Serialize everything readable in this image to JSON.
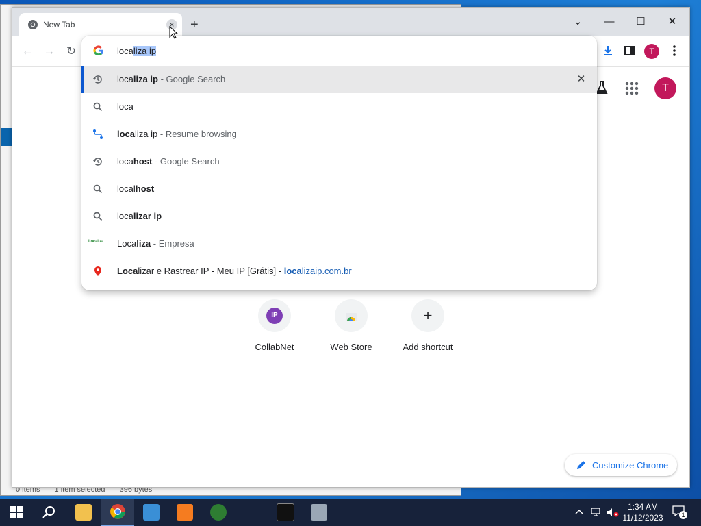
{
  "background_window": {
    "status_items": "0 items",
    "status_selected": "1 item selected",
    "status_size": "396 bytes"
  },
  "tab": {
    "title": "New Tab",
    "close_symbol": "×"
  },
  "new_tab_symbol": "+",
  "window_controls": {
    "tab_search": "⌄",
    "minimize": "—",
    "maximize": "☐",
    "close": "✕"
  },
  "toolbar": {
    "back": "←",
    "forward": "→",
    "reload": "↻",
    "avatar_letter": "T"
  },
  "omnibox": {
    "typed": "loca",
    "autocomplete": "liza ip",
    "suggestions": [
      {
        "icon": "history-icon",
        "bold_prefix": "",
        "plain": "loca",
        "bold": "liza ip",
        "desc": " - Google Search",
        "removable": true
      },
      {
        "icon": "search-icon",
        "plain": "loca",
        "bold": ""
      },
      {
        "icon": "resume-journey-icon",
        "bold_prefix": "loca",
        "plain": "liza ip",
        "desc": " - Resume browsing"
      },
      {
        "icon": "history-icon",
        "plain": "loca",
        "bold": "host",
        "desc": " - Google Search"
      },
      {
        "icon": "search-icon",
        "plain": "local",
        "bold": "host"
      },
      {
        "icon": "search-icon",
        "plain": "loca",
        "bold": "lizar ip"
      },
      {
        "icon": "localiza-logo",
        "plain": "Loca",
        "bold": "liza",
        "desc": " - Empresa",
        "logo_text": "Localiza"
      },
      {
        "icon": "location-pin-icon",
        "bold_prefix": "Loca",
        "plain": "lizar e Rastrear IP - Meu IP [Grátis] - ",
        "url_bold": "loca",
        "url_plain": "lizaip.com.br"
      }
    ],
    "remove_symbol": "✕"
  },
  "ntp": {
    "avatar_letter": "T",
    "shortcuts": [
      {
        "label": "CollabNet",
        "badge": "IP"
      },
      {
        "label": "Web Store"
      },
      {
        "label": "Add shortcut",
        "symbol": "+"
      }
    ],
    "customize_label": "Customize Chrome"
  },
  "taskbar": {
    "time": "1:34 AM",
    "date": "11/12/2023",
    "notification_count": "1",
    "apps": [
      "start",
      "search",
      "file-explorer",
      "chrome",
      "control-panel",
      "xampp",
      "hs",
      "iast",
      "terminal",
      "server-manager"
    ]
  },
  "colors": {
    "accent": "#1a73e8",
    "avatar": "#c2185b",
    "taskbar": "#17223a",
    "selection": "#a8c7fa"
  }
}
